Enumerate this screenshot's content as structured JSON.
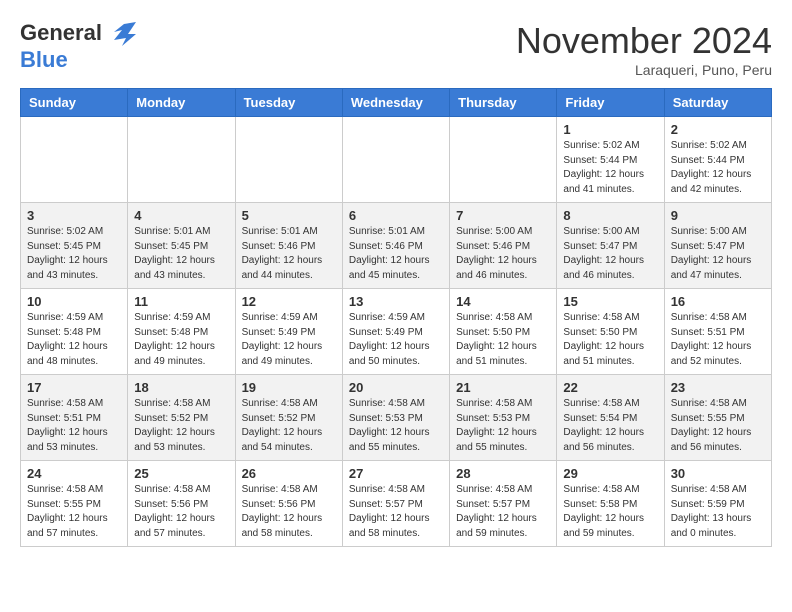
{
  "header": {
    "logo_line1": "General",
    "logo_line2": "Blue",
    "month": "November 2024",
    "location": "Laraqueri, Puno, Peru"
  },
  "days_of_week": [
    "Sunday",
    "Monday",
    "Tuesday",
    "Wednesday",
    "Thursday",
    "Friday",
    "Saturday"
  ],
  "weeks": [
    [
      {
        "day": "",
        "info": ""
      },
      {
        "day": "",
        "info": ""
      },
      {
        "day": "",
        "info": ""
      },
      {
        "day": "",
        "info": ""
      },
      {
        "day": "",
        "info": ""
      },
      {
        "day": "1",
        "info": "Sunrise: 5:02 AM\nSunset: 5:44 PM\nDaylight: 12 hours\nand 41 minutes."
      },
      {
        "day": "2",
        "info": "Sunrise: 5:02 AM\nSunset: 5:44 PM\nDaylight: 12 hours\nand 42 minutes."
      }
    ],
    [
      {
        "day": "3",
        "info": "Sunrise: 5:02 AM\nSunset: 5:45 PM\nDaylight: 12 hours\nand 43 minutes."
      },
      {
        "day": "4",
        "info": "Sunrise: 5:01 AM\nSunset: 5:45 PM\nDaylight: 12 hours\nand 43 minutes."
      },
      {
        "day": "5",
        "info": "Sunrise: 5:01 AM\nSunset: 5:46 PM\nDaylight: 12 hours\nand 44 minutes."
      },
      {
        "day": "6",
        "info": "Sunrise: 5:01 AM\nSunset: 5:46 PM\nDaylight: 12 hours\nand 45 minutes."
      },
      {
        "day": "7",
        "info": "Sunrise: 5:00 AM\nSunset: 5:46 PM\nDaylight: 12 hours\nand 46 minutes."
      },
      {
        "day": "8",
        "info": "Sunrise: 5:00 AM\nSunset: 5:47 PM\nDaylight: 12 hours\nand 46 minutes."
      },
      {
        "day": "9",
        "info": "Sunrise: 5:00 AM\nSunset: 5:47 PM\nDaylight: 12 hours\nand 47 minutes."
      }
    ],
    [
      {
        "day": "10",
        "info": "Sunrise: 4:59 AM\nSunset: 5:48 PM\nDaylight: 12 hours\nand 48 minutes."
      },
      {
        "day": "11",
        "info": "Sunrise: 4:59 AM\nSunset: 5:48 PM\nDaylight: 12 hours\nand 49 minutes."
      },
      {
        "day": "12",
        "info": "Sunrise: 4:59 AM\nSunset: 5:49 PM\nDaylight: 12 hours\nand 49 minutes."
      },
      {
        "day": "13",
        "info": "Sunrise: 4:59 AM\nSunset: 5:49 PM\nDaylight: 12 hours\nand 50 minutes."
      },
      {
        "day": "14",
        "info": "Sunrise: 4:58 AM\nSunset: 5:50 PM\nDaylight: 12 hours\nand 51 minutes."
      },
      {
        "day": "15",
        "info": "Sunrise: 4:58 AM\nSunset: 5:50 PM\nDaylight: 12 hours\nand 51 minutes."
      },
      {
        "day": "16",
        "info": "Sunrise: 4:58 AM\nSunset: 5:51 PM\nDaylight: 12 hours\nand 52 minutes."
      }
    ],
    [
      {
        "day": "17",
        "info": "Sunrise: 4:58 AM\nSunset: 5:51 PM\nDaylight: 12 hours\nand 53 minutes."
      },
      {
        "day": "18",
        "info": "Sunrise: 4:58 AM\nSunset: 5:52 PM\nDaylight: 12 hours\nand 53 minutes."
      },
      {
        "day": "19",
        "info": "Sunrise: 4:58 AM\nSunset: 5:52 PM\nDaylight: 12 hours\nand 54 minutes."
      },
      {
        "day": "20",
        "info": "Sunrise: 4:58 AM\nSunset: 5:53 PM\nDaylight: 12 hours\nand 55 minutes."
      },
      {
        "day": "21",
        "info": "Sunrise: 4:58 AM\nSunset: 5:53 PM\nDaylight: 12 hours\nand 55 minutes."
      },
      {
        "day": "22",
        "info": "Sunrise: 4:58 AM\nSunset: 5:54 PM\nDaylight: 12 hours\nand 56 minutes."
      },
      {
        "day": "23",
        "info": "Sunrise: 4:58 AM\nSunset: 5:55 PM\nDaylight: 12 hours\nand 56 minutes."
      }
    ],
    [
      {
        "day": "24",
        "info": "Sunrise: 4:58 AM\nSunset: 5:55 PM\nDaylight: 12 hours\nand 57 minutes."
      },
      {
        "day": "25",
        "info": "Sunrise: 4:58 AM\nSunset: 5:56 PM\nDaylight: 12 hours\nand 57 minutes."
      },
      {
        "day": "26",
        "info": "Sunrise: 4:58 AM\nSunset: 5:56 PM\nDaylight: 12 hours\nand 58 minutes."
      },
      {
        "day": "27",
        "info": "Sunrise: 4:58 AM\nSunset: 5:57 PM\nDaylight: 12 hours\nand 58 minutes."
      },
      {
        "day": "28",
        "info": "Sunrise: 4:58 AM\nSunset: 5:57 PM\nDaylight: 12 hours\nand 59 minutes."
      },
      {
        "day": "29",
        "info": "Sunrise: 4:58 AM\nSunset: 5:58 PM\nDaylight: 12 hours\nand 59 minutes."
      },
      {
        "day": "30",
        "info": "Sunrise: 4:58 AM\nSunset: 5:59 PM\nDaylight: 13 hours\nand 0 minutes."
      }
    ]
  ]
}
